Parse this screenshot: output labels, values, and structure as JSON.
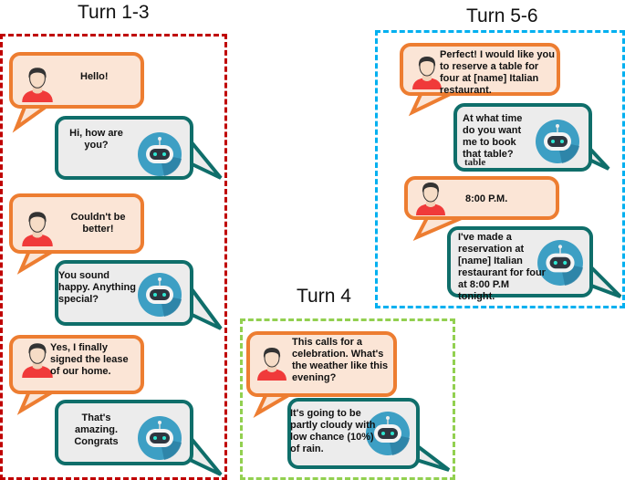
{
  "groups": [
    {
      "title": "Turn 1-3",
      "border_color": "#c00000",
      "messages": [
        {
          "speaker": "user",
          "text": "Hello!"
        },
        {
          "speaker": "bot",
          "text": "Hi, how are you?"
        },
        {
          "speaker": "user",
          "text": "Couldn't be better!"
        },
        {
          "speaker": "bot",
          "text": "You sound happy. Anything special?"
        },
        {
          "speaker": "user",
          "text": "Yes, I finally signed the lease of our home."
        },
        {
          "speaker": "bot",
          "text": "That's amazing. Congrats"
        }
      ]
    },
    {
      "title": "Turn 4",
      "border_color": "#92d050",
      "messages": [
        {
          "speaker": "user",
          "text": "This calls for a celebration. What's the weather like this evening?"
        },
        {
          "speaker": "bot",
          "text": "It's going to be partly cloudy with low chance (10%) of rain."
        }
      ]
    },
    {
      "title": "Turn 5-6",
      "border_color": "#00b0f0",
      "messages": [
        {
          "speaker": "user",
          "text": "Perfect! I would like you to reserve a table for four at [name] Italian restaurant."
        },
        {
          "speaker": "bot",
          "text": "At what time do you want me to book that table?",
          "note": "table"
        },
        {
          "speaker": "user",
          "text": "8:00 P.M."
        },
        {
          "speaker": "bot",
          "text": "I've made a reservation at [name] Italian restaurant for four at 8:00 P.M tonight."
        }
      ]
    }
  ],
  "icons": {
    "user": "user-avatar-icon",
    "bot": "robot-icon"
  },
  "colors": {
    "user_fill": "#fbe5d6",
    "user_border": "#ed7d31",
    "bot_fill": "#ececec",
    "bot_border": "#0f6e6a",
    "robot_bg": "#3d9fc4"
  }
}
